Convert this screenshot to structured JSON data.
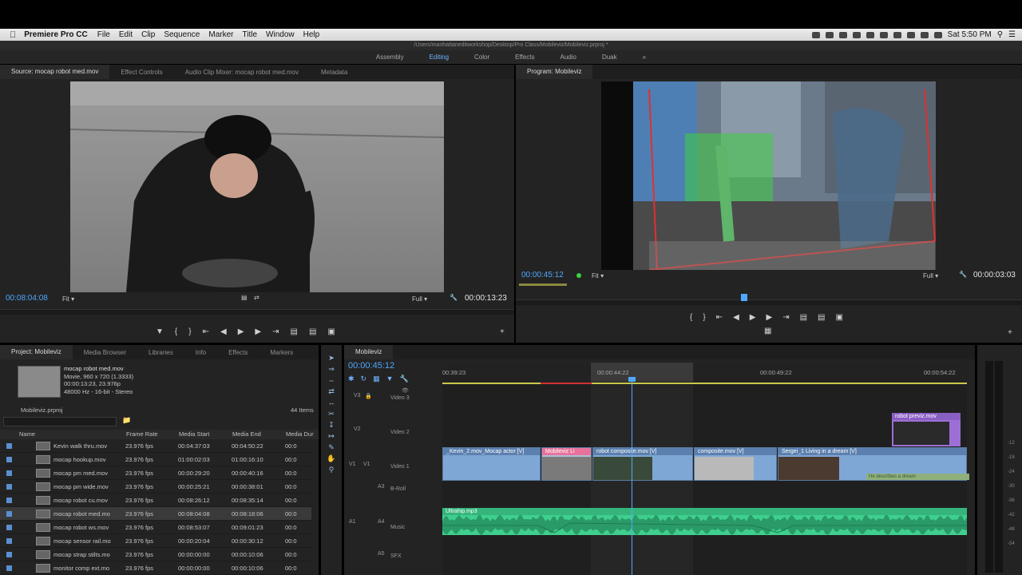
{
  "menubar": {
    "apple": "",
    "app": "Premiere Pro CC",
    "items": [
      "File",
      "Edit",
      "Clip",
      "Sequence",
      "Marker",
      "Title",
      "Window",
      "Help"
    ],
    "clock": "Sat 5:50 PM"
  },
  "titlebar": {
    "path": "/Users/manhattaneditworkshop/Desktop/Pro Class/Mobileviz/Mobileviz.prproj *"
  },
  "workspaces": [
    "Assembly",
    "Editing",
    "Color",
    "Effects",
    "Audio",
    "Duak"
  ],
  "active_workspace": "Editing",
  "source": {
    "tabs": [
      "Source: mocap robot med.mov",
      "Effect Controls",
      "Audio Clip Mixer: mocap robot med.mov",
      "Metadata"
    ],
    "timecode_left": "00:08:04:08",
    "fit": "Fit",
    "full": "Full",
    "timecode_right": "00:00:13:23"
  },
  "program": {
    "tab": "Program: Mobileviz",
    "timecode_left": "00:00:45:12",
    "fit": "Fit",
    "full": "Full",
    "timecode_right": "00:00:03:03"
  },
  "project": {
    "tabs": [
      "Project: Mobileviz",
      "Media Browser",
      "Libraries",
      "Info",
      "Effects",
      "Markers"
    ],
    "clip_name": "mocap robot med.mov",
    "clip_info1": "Movie, 960 x 720 (1.3333)",
    "clip_info2": "00:00:13:23, 23.976p",
    "clip_info3": "48000 Hz - 16-bit - Stereo",
    "proj_file": "Mobileviz.prproj",
    "item_count": "44 Items",
    "columns": [
      "Name",
      "Frame Rate",
      "Media Start",
      "Media End",
      "Media Dur"
    ],
    "rows": [
      {
        "name": "Kevin walk thru.mov",
        "rate": "23.976 fps",
        "start": "00:04:37:03",
        "end": "00:04:50:22",
        "dur": "00:0"
      },
      {
        "name": "mocap hookup.mov",
        "rate": "23.976 fps",
        "start": "01:00:02:03",
        "end": "01:00:16:10",
        "dur": "00:0"
      },
      {
        "name": "mocap pm med.mov",
        "rate": "23.976 fps",
        "start": "00:00:29:20",
        "end": "00:00:40:16",
        "dur": "00:0"
      },
      {
        "name": "mocap pm wide.mov",
        "rate": "23.976 fps",
        "start": "00:00:25:21",
        "end": "00:00:38:01",
        "dur": "00:0"
      },
      {
        "name": "mocap robot cu.mov",
        "rate": "23.976 fps",
        "start": "00:08:26:12",
        "end": "00:08:35:14",
        "dur": "00:0"
      },
      {
        "name": "mocap robot med.mo",
        "rate": "23.976 fps",
        "start": "00:08:04:08",
        "end": "00:08:18:06",
        "dur": "00:0"
      },
      {
        "name": "mocap robot ws.mov",
        "rate": "23.976 fps",
        "start": "00:08:53:07",
        "end": "00:09:01:23",
        "dur": "00:0"
      },
      {
        "name": "mocap sensor rail.mo",
        "rate": "23.976 fps",
        "start": "00:00:20:04",
        "end": "00:00:30:12",
        "dur": "00:0"
      },
      {
        "name": "mocap strap stilts.mo",
        "rate": "23.976 fps",
        "start": "00:00:00:00",
        "end": "00:00:10:06",
        "dur": "00:0"
      },
      {
        "name": "monitor comp ext.mo",
        "rate": "23.976 fps",
        "start": "00:00:00:00",
        "end": "00:00:10:06",
        "dur": "00:0"
      }
    ],
    "selected_row": 5
  },
  "timeline": {
    "tab": "Mobileviz",
    "timecode": "00:00:45:12",
    "ruler": [
      "00:39:23",
      "00:00:44:22",
      "00:00:49:22",
      "00:00:54:22"
    ],
    "tracks": {
      "v3": "V3",
      "v3_name": "Video 3",
      "v2": "V2",
      "v2_name": "Video 2",
      "v1": "V1",
      "v1_src": "V1",
      "v1_name": "Video 1",
      "a3": "A3",
      "a3_name": "B-Roll",
      "a1": "A1",
      "a4": "A4",
      "a4_name": "Music",
      "a5": "A5",
      "a5_name": "SFX"
    },
    "clips": {
      "c1": "_Kevin_2.mov_Mocap actor [V]",
      "c2": "Mobileviz Li",
      "c3": "robot composite.mov [V]",
      "c4": "composite.mov [V]",
      "c5": "Sergei_1 Living in a dream [V]",
      "c5_sub": "He describes a dream",
      "v2clip": "robot previz.mov",
      "audio": "Ultrahip.mp3"
    }
  },
  "meter": {
    "ticks": [
      "-12",
      "-18",
      "-24",
      "-30",
      "-36",
      "-42",
      "-48",
      "-54"
    ]
  },
  "colors": {
    "accent": "#4fa8ff",
    "video_clip": "#7fa7d6",
    "audio_clip": "#3fcf8e",
    "pink_clip": "#e8729c",
    "purple_clip": "#9d6fd6"
  }
}
